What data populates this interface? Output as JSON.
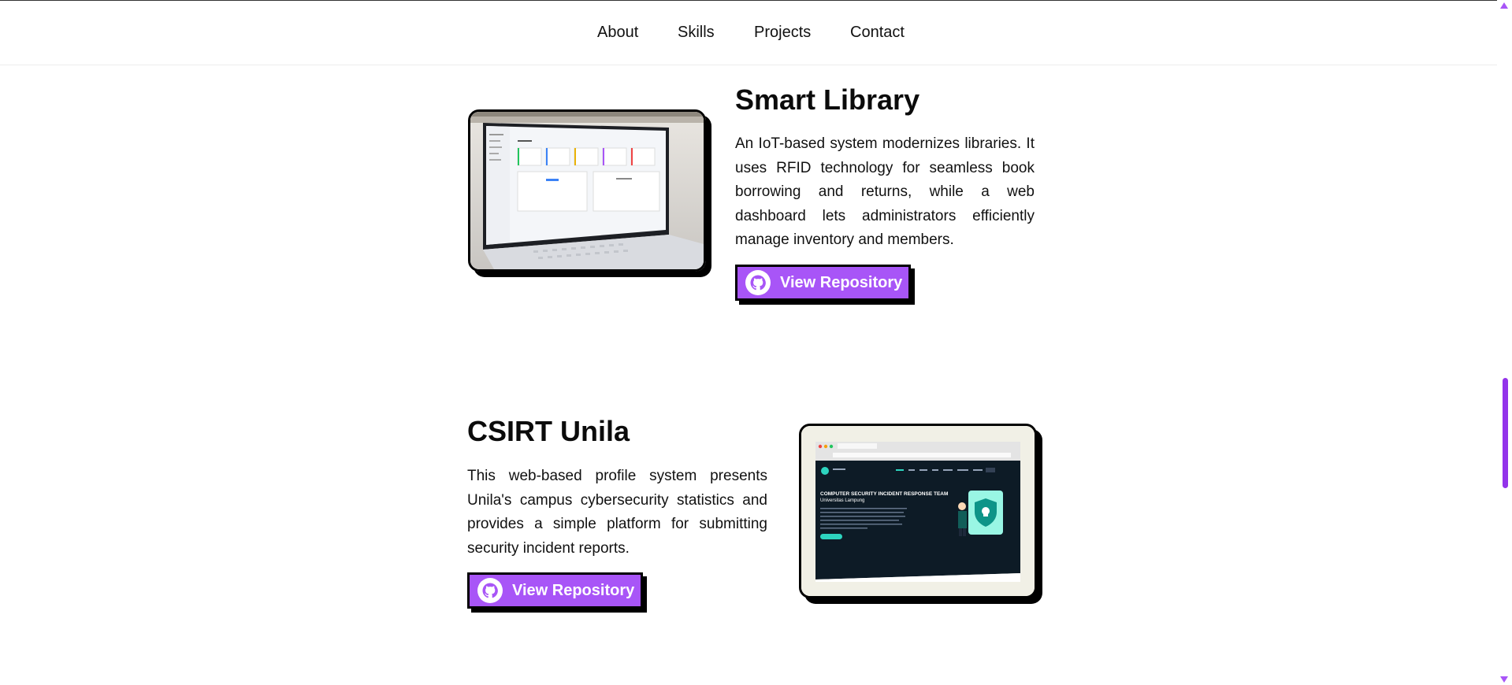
{
  "nav": {
    "items": [
      "About",
      "Skills",
      "Projects",
      "Contact"
    ]
  },
  "projects": [
    {
      "title": "Smart Library",
      "description": "An IoT-based system modernizes libraries. It uses RFID technology for seamless book borrowing and returns, while a web dashboard lets administrators efficiently manage inventory and members.",
      "button_label": "View Repository",
      "button_icon": "github-icon"
    },
    {
      "title": "CSIRT Unila",
      "description": "This web-based profile system presents Unila's campus cybersecurity statistics and provides a simple platform for submitting security incident reports.",
      "button_label": "View Repository",
      "button_icon": "github-icon"
    }
  ],
  "csirt_preview": {
    "headline": "COMPUTER SECURITY INCIDENT RESPONSE TEAM",
    "subline": "Universitas Lampung"
  },
  "colors": {
    "accent": "#a855f7",
    "scroll_thumb": "#9333ea",
    "text": "#111111"
  }
}
